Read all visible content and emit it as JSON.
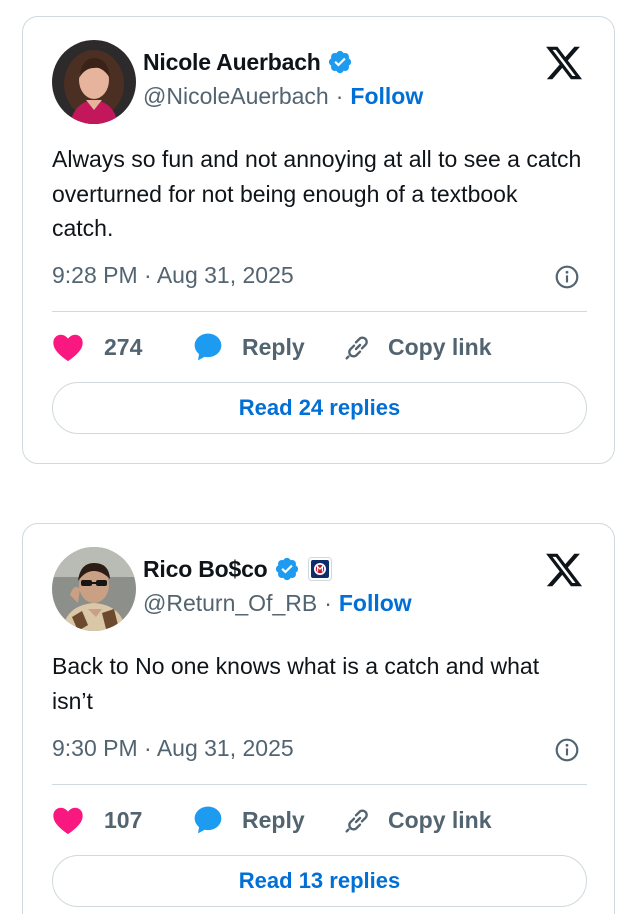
{
  "tweets": [
    {
      "author_name": "Nicole Auerbach",
      "handle": "@NicoleAuerbach",
      "separator": "·",
      "follow_label": "Follow",
      "text": "Always so fun and not annoying at all to see a catch overturned for not being enough of a textbook catch.",
      "time": "9:28 PM · Aug 31, 2025",
      "likes": "274",
      "reply_label": "Reply",
      "copy_link_label": "Copy link",
      "read_replies_label": "Read 24 replies",
      "verified": true
    },
    {
      "author_name": "Rico Bo$co",
      "handle": "@Return_Of_RB",
      "separator": "·",
      "follow_label": "Follow",
      "text": "Back to No one knows what is a catch and what isn’t",
      "time": "9:30 PM · Aug 31, 2025",
      "likes": "107",
      "reply_label": "Reply",
      "copy_link_label": "Copy link",
      "read_replies_label": "Read 13 replies",
      "verified": true,
      "affiliate_badge_icon": "affiliate-badge-icon"
    }
  ],
  "colors": {
    "verified": "#1d9bf0",
    "like": "#f91880",
    "reply": "#1d9bf0",
    "link": "#006fd6",
    "muted": "#536471",
    "border": "#cfd9de"
  },
  "icons": {
    "platform": "x-logo-icon",
    "verified": "verified-badge-icon",
    "like": "heart-icon",
    "reply": "speech-bubble-icon",
    "copy": "link-icon",
    "info": "info-icon"
  }
}
